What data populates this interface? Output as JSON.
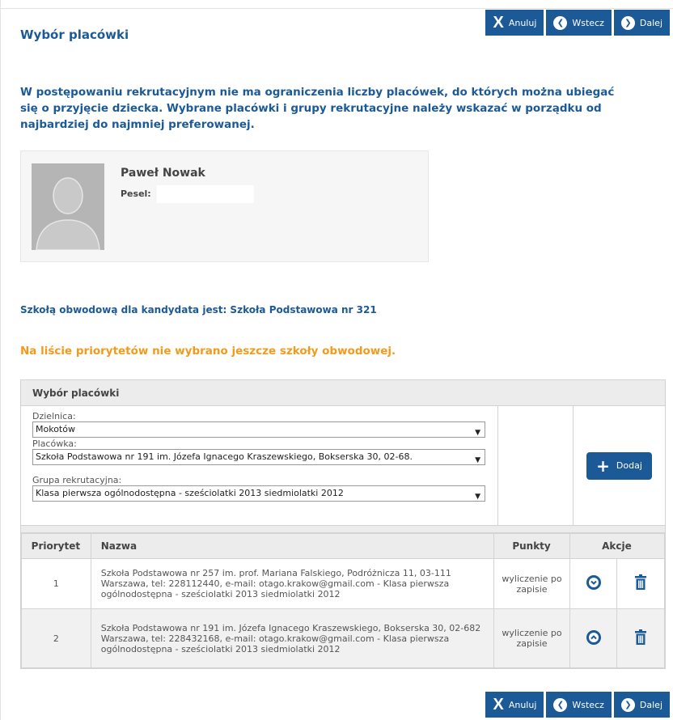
{
  "nav": {
    "cancel": "Anuluj",
    "back": "Wstecz",
    "next": "Dalej"
  },
  "page_title": "Wybór placówki",
  "intro": "W postępowaniu rekrutacyjnym nie ma ograniczenia liczby placówek, do których można ubiegać się o przyjęcie dziecka. Wybrane placówki i grupy rekrutacyjne należy wskazać w porządku od najbardziej do najmniej preferowanej.",
  "candidate": {
    "name": "Paweł Nowak",
    "pesel_label": "Pesel:",
    "pesel_value": ""
  },
  "district_school_info": "Szkołą obwodową dla kandydata jest: Szkoła Podstawowa nr 321",
  "warning": "Na liście priorytetów nie wybrano jeszcze szkoły obwodowej.",
  "selection": {
    "header": "Wybór placówki",
    "district_label": "Dzielnica:",
    "district_value": "Mokotów",
    "school_label": "Placówka:",
    "school_value": "Szkoła Podstawowa nr 191 im. Józefa Ignacego Kraszewskiego, Bokserska 30, 02-68.",
    "group_label": "Grupa rekrutacyjna:",
    "group_value": "Klasa pierwsza ogólnodostępna - sześciolatki 2013 siedmiolatki 2012",
    "add_label": "Dodaj"
  },
  "table": {
    "headers": {
      "priority": "Priorytet",
      "name": "Nazwa",
      "points": "Punkty",
      "actions": "Akcje"
    },
    "rows": [
      {
        "priority": "1",
        "name": "Szkoła Podstawowa nr 257 im. prof. Mariana Falskiego, Podróżnicza 11, 03-111 Warszawa, tel: 228112440, e-mail: otago.krakow@gmail.com - Klasa pierwsza ogólnodostępna - sześciolatki 2013 siedmiolatki 2012",
        "points": "wyliczenie po zapisie"
      },
      {
        "priority": "2",
        "name": "Szkoła Podstawowa nr 191 im. Józefa Ignacego Kraszewskiego, Bokserska 30, 02-682 Warszawa, tel: 228432168, e-mail: otago.krakow@gmail.com - Klasa pierwsza ogólnodostępna - sześciolatki 2013 siedmiolatki 2012",
        "points": "wyliczenie po zapisie"
      }
    ]
  },
  "colors": {
    "primary": "#1c5a97",
    "warning": "#f29a1b"
  }
}
